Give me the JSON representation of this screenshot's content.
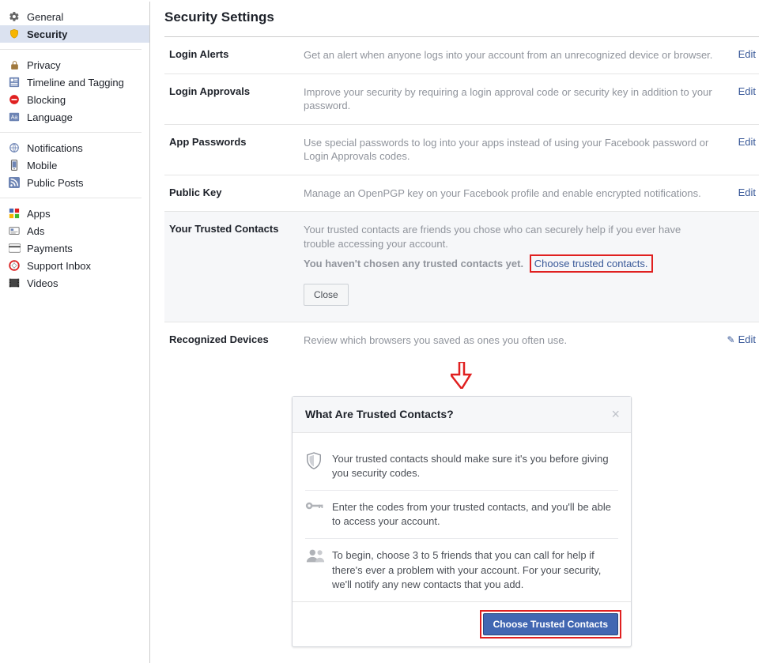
{
  "sidebar": {
    "items": [
      {
        "label": "General"
      },
      {
        "label": "Security"
      },
      {
        "label": "Privacy"
      },
      {
        "label": "Timeline and Tagging"
      },
      {
        "label": "Blocking"
      },
      {
        "label": "Language"
      },
      {
        "label": "Notifications"
      },
      {
        "label": "Mobile"
      },
      {
        "label": "Public Posts"
      },
      {
        "label": "Apps"
      },
      {
        "label": "Ads"
      },
      {
        "label": "Payments"
      },
      {
        "label": "Support Inbox"
      },
      {
        "label": "Videos"
      }
    ]
  },
  "page": {
    "title": "Security Settings"
  },
  "edit_label": "Edit",
  "rows": {
    "login_alerts": {
      "label": "Login Alerts",
      "desc": "Get an alert when anyone logs into your account from an unrecognized device or browser."
    },
    "login_approvals": {
      "label": "Login Approvals",
      "desc": "Improve your security by requiring a login approval code or security key in addition to your password."
    },
    "app_passwords": {
      "label": "App Passwords",
      "desc": "Use special passwords to log into your apps instead of using your Facebook password or Login Approvals codes."
    },
    "public_key": {
      "label": "Public Key",
      "desc": "Manage an OpenPGP key on your Facebook profile and enable encrypted notifications."
    },
    "trusted": {
      "label": "Your Trusted Contacts",
      "desc": "Your trusted contacts are friends you chose who can securely help if you ever have trouble accessing your account.",
      "not_chosen": "You haven't chosen any trusted contacts yet.",
      "choose_link": "Choose trusted contacts.",
      "close": "Close"
    },
    "recognized": {
      "label": "Recognized Devices",
      "desc": "Review which browsers you saved as ones you often use."
    }
  },
  "dialog": {
    "title": "What Are Trusted Contacts?",
    "line1": "Your trusted contacts should make sure it's you before giving you security codes.",
    "line2": "Enter the codes from your trusted contacts, and you'll be able to access your account.",
    "line3": "To begin, choose 3 to 5 friends that you can call for help if there's ever a problem with your account. For your security, we'll notify any new contacts that you add.",
    "cta": "Choose Trusted Contacts"
  }
}
